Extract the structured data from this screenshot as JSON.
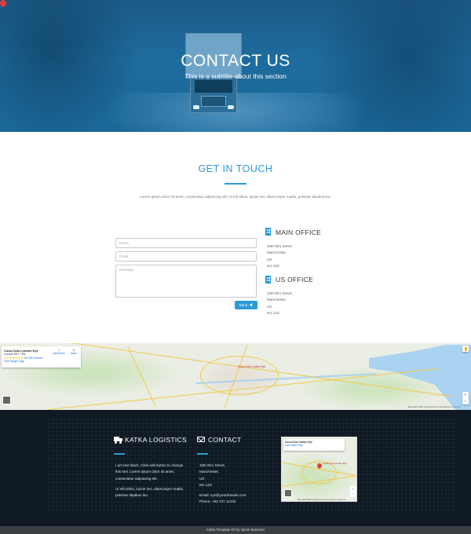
{
  "hero": {
    "title": "CONTACT US",
    "subtitle": "This is a subtitle about this section"
  },
  "touch": {
    "title": "GET IN TOUCH",
    "text": "Lorem ipsum dolor sit amet, consectetur adipiscing elit. Ut elit tellus, luctus nec ullamcorper mattis, pulvinar dapibus leo."
  },
  "form": {
    "name_placeholder": "Name",
    "email_placeholder": "Email",
    "message_placeholder": "Message",
    "send_label": "Send",
    "send_icon": "send-icon"
  },
  "offices": {
    "main": {
      "title": "MAIN OFFICE",
      "line1": "10th Elm Street,",
      "line2": "Manchester,",
      "line3": "UK",
      "line4": "M1 1ZX"
    },
    "us": {
      "title": "US OFFICE",
      "line1": "10th Elm Street,",
      "line2": "Manchester,",
      "line3": "UK",
      "line4": "M1 1ZX"
    }
  },
  "map": {
    "place_name": "Coca-Cola London Eye",
    "address": "London SE1 7PB",
    "rating": "4.5 ★★★★★",
    "reviews": "94,238 reviews",
    "larger_map": "View larger map",
    "directions": "Directions",
    "save": "Save",
    "pin_label": "Coca-Cola London Eye",
    "footer": "Map data ©2023 Google   Terms of Use   Report a map error",
    "zoom_in": "+",
    "zoom_out": "−"
  },
  "footer": {
    "brand_title": "KATKA LOGISTICS",
    "brand_text1": "I am text block. Click edit button to change this text. Lorem ipsum dolor sit amet, consectetur adipiscing elit.",
    "brand_text2": "Ut elit tellus, luctus nec ullamcorper mattis, pulvinar dapibus leo.",
    "contact_title": "CONTACT",
    "contact_line1": "10th Elm Street,",
    "contact_line2": "Manchester,",
    "contact_line3": "UK",
    "contact_line4": "M1 1ZX",
    "contact_email": "Email: xyz@yourdomain.com",
    "contact_phone": "Phone: +94 727 11233",
    "mini_map_title": "Coca-Cola London Eye",
    "mini_map_link": "View larger map",
    "mini_pin_label": "Coca-Cola London Eye",
    "mini_map_footer": "Map data ©2023 Google  Terms of Use  Report a map error"
  },
  "copyright": "Katka Template Kit by Jamie Burleson",
  "colors": {
    "accent": "#2c9ad6",
    "footer_bg": "#0f1a24",
    "hero_overlay": "#1e6c9e"
  }
}
